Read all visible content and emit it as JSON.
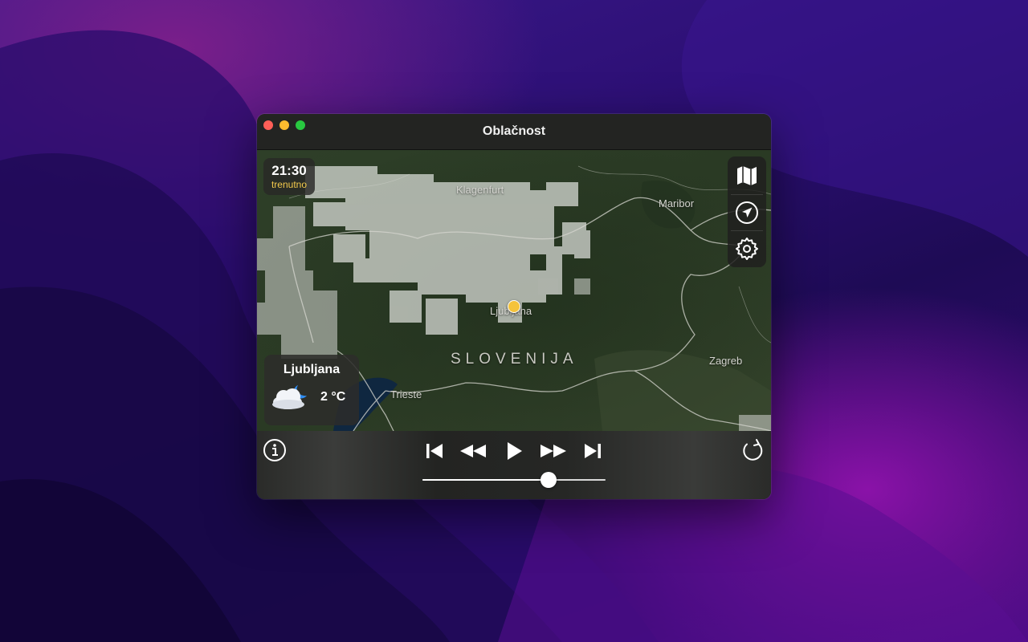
{
  "window": {
    "title": "Oblačnost"
  },
  "map": {
    "labels": {
      "klagenfurt": "Klagenfurt",
      "maribor": "Maribor",
      "ljubljana": "Ljubljana",
      "country": "SLOVENIJA",
      "zagreb": "Zagreb",
      "trieste": "Trieste"
    },
    "location_dot_color": "#f5c33b"
  },
  "time_box": {
    "time": "21:30",
    "status": "trenutno"
  },
  "tools": {
    "items": [
      {
        "icon": "map-icon"
      },
      {
        "icon": "location-arrow-icon"
      },
      {
        "icon": "gear-icon"
      }
    ]
  },
  "weather_card": {
    "city": "Ljubljana",
    "temperature": "2 °C",
    "icon": "partly-cloudy-night-icon"
  },
  "player": {
    "buttons": [
      "info-icon",
      "skip-to-start-icon",
      "rewind-icon",
      "play-icon",
      "fast-forward-icon",
      "skip-to-end-icon",
      "reload-icon"
    ],
    "progress": 0.69
  },
  "colors": {
    "accent": "#f2c94c",
    "close": "#ff5f57",
    "minimize": "#febc2e",
    "maximize": "#28c840"
  }
}
